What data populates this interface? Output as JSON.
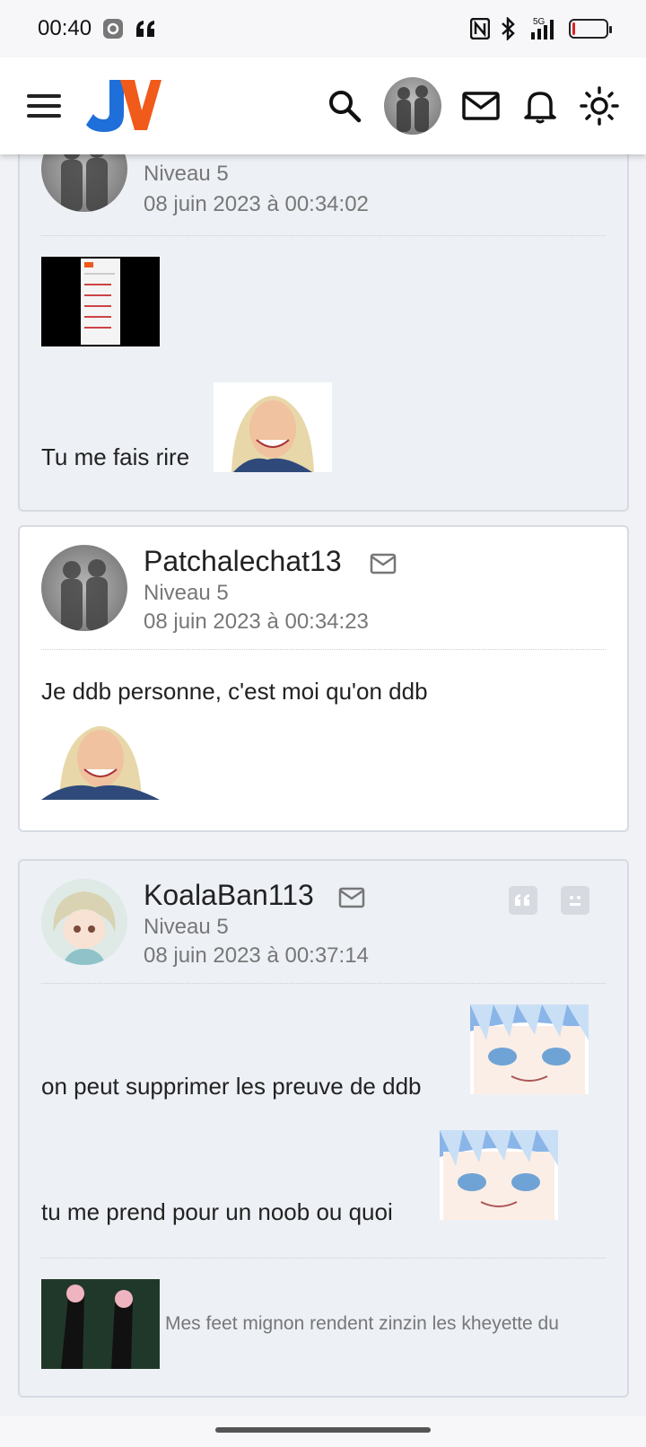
{
  "status_bar": {
    "time": "00:40",
    "network": "5G",
    "icons": [
      "settings-icon",
      "quote-app-icon",
      "nfc-icon",
      "bluetooth-icon",
      "signal-icon",
      "battery-icon"
    ]
  },
  "app_bar": {
    "logo_text": "JV",
    "icons": [
      "menu-icon",
      "search-icon",
      "avatar",
      "mail-icon",
      "bell-icon",
      "brightness-icon"
    ],
    "colors": {
      "logo_blue": "#1e6fd9",
      "logo_orange": "#f05a1a"
    }
  },
  "posts": [
    {
      "author": "",
      "level": "Niveau 5",
      "date": "08 juin 2023 à 00:34:02",
      "quote_image": "screenshot-thumbnail",
      "text": "Tu me fais rire",
      "sticker": "smiling-woman-sticker"
    },
    {
      "author": "Patchalechat13",
      "level": "Niveau 5",
      "date": "08 juin 2023 à 00:34:23",
      "text": "Je ddb personne, c'est moi qu'on ddb",
      "sticker": "smiling-woman-sticker"
    },
    {
      "author": "KoalaBan113",
      "level": "Niveau 5",
      "date": "08 juin 2023 à 00:37:14",
      "lines": [
        {
          "text": "on peut supprimer les preuve de ddb",
          "sticker": "anime-girl-sticker"
        },
        {
          "text": "tu me prend pour un noob ou quoi",
          "sticker": "anime-girl-sticker"
        }
      ],
      "signature": "Mes feet mignon rendent zinzin les kheyette du",
      "signature_image": "feet-photo"
    }
  ]
}
